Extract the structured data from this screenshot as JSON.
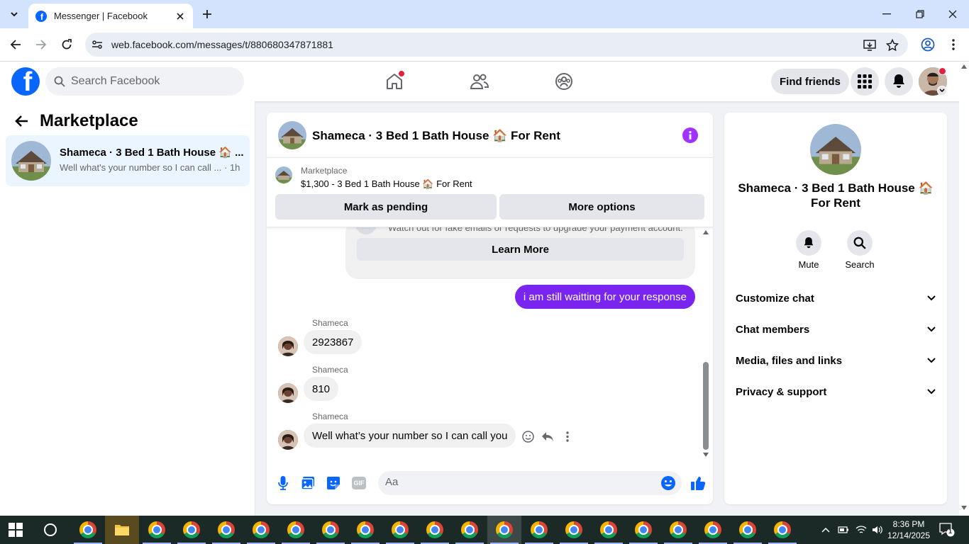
{
  "browser": {
    "tab_title": "Messenger | Facebook",
    "url": "web.facebook.com/messages/t/880680347871881"
  },
  "fb": {
    "search_placeholder": "Search Facebook",
    "find_friends": "Find friends",
    "brand_color": "#0866ff"
  },
  "sidebar": {
    "title": "Marketplace",
    "conversation": {
      "title": "Shameca · 3 Bed 1 Bath House 🏠 ...",
      "snippet": "Well what's your number so I can call ... · 1h"
    }
  },
  "chat": {
    "title": "Shameca · 3 Bed 1 Bath House 🏠 For Rent",
    "accent_color": "#a033ff",
    "marketplace": {
      "label": "Marketplace",
      "listing": "$1,300 - 3 Bed 1 Bath House 🏠 For Rent",
      "mark_pending": "Mark as pending",
      "more_options": "More options"
    },
    "scam_notice": {
      "text": "Watch out for fake emails or requests to upgrade your payment account.",
      "learn_more": "Learn More"
    },
    "messages": [
      {
        "from": "me",
        "text": "i am still waitting for your response"
      },
      {
        "from": "Shameca",
        "text": "2923867"
      },
      {
        "from": "Shameca",
        "text": "810"
      },
      {
        "from": "Shameca",
        "text": "Well what’s your number so I can call you"
      }
    ],
    "composer_placeholder": "Aa",
    "gif_label": "GIF"
  },
  "details": {
    "title": "Shameca · 3 Bed 1 Bath House 🏠 For Rent",
    "mute": "Mute",
    "search": "Search",
    "sections": [
      "Customize chat",
      "Chat members",
      "Media, files and links",
      "Privacy & support"
    ]
  },
  "taskbar": {
    "time": "8:36 PM",
    "date": "12/14/2025",
    "notifications": "1"
  }
}
